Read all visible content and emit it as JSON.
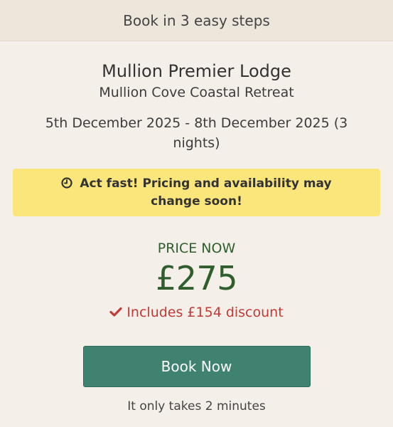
{
  "header": {
    "title": "Book in 3 easy steps"
  },
  "property": {
    "name": "Mullion Premier Lodge",
    "location": "Mullion Cove Coastal Retreat",
    "dates": "5th December 2025 - 8th December 2025 (3 nights)"
  },
  "alert": {
    "icon": "clock-icon",
    "text": "Act fast! Pricing and availability may change soon!"
  },
  "pricing": {
    "label": "PRICE NOW",
    "amount": "£275",
    "discount_icon": "check-icon",
    "discount_text": "Includes £154 discount"
  },
  "cta": {
    "label": "Book Now",
    "note": "It only takes 2 minutes"
  },
  "colors": {
    "header_bg": "#ede6db",
    "page_bg": "#f4efe9",
    "alert_bg": "#fbe67c",
    "price_green": "#2f5e2c",
    "discount_red": "#c23a36",
    "button_green": "#3f8270"
  }
}
